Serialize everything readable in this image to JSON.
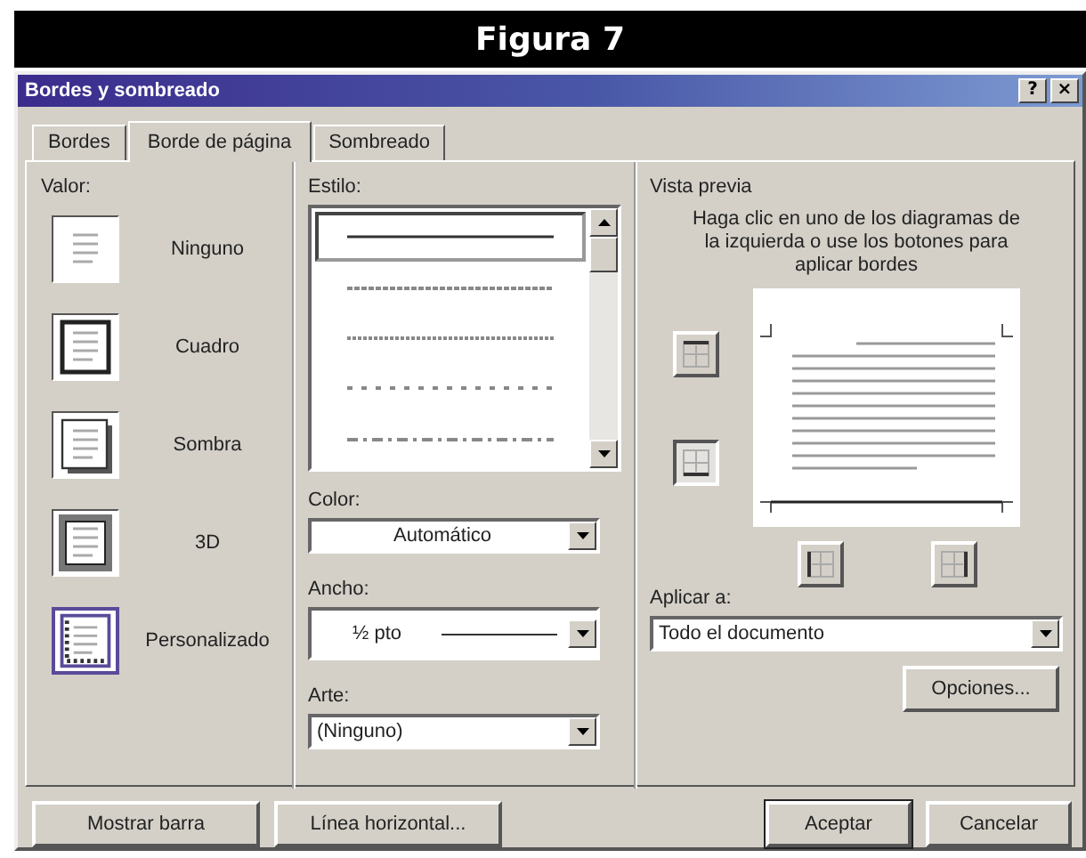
{
  "figure": {
    "caption": "Figura 7"
  },
  "window": {
    "title": "Bordes y sombreado",
    "controls": [
      {
        "label": "?"
      },
      {
        "label": "×"
      }
    ]
  },
  "tabs": [
    {
      "label": "Bordes",
      "selected": false
    },
    {
      "label": "Borde de página",
      "selected": true
    },
    {
      "label": "Sombreado",
      "selected": false
    }
  ],
  "setting": {
    "label": "Valor:",
    "options": [
      {
        "label": "Ninguno",
        "kind": "none",
        "selected": false
      },
      {
        "label": "Cuadro",
        "kind": "box",
        "selected": false
      },
      {
        "label": "Sombra",
        "kind": "shadow",
        "selected": false
      },
      {
        "label": "3D",
        "kind": "raised",
        "selected": false
      },
      {
        "label": "Personalizado",
        "kind": "custom",
        "selected": true
      }
    ]
  },
  "style": {
    "label": "Estilo:",
    "lines": [
      {
        "kind": "solid",
        "selected": true
      },
      {
        "kind": "dotted",
        "selected": false
      },
      {
        "kind": "dense-dash",
        "selected": false
      },
      {
        "kind": "dash",
        "selected": false
      },
      {
        "kind": "dash-dot",
        "selected": false
      }
    ]
  },
  "color": {
    "label": "Color:",
    "value": "Automático"
  },
  "width": {
    "label": "Ancho:",
    "value": "½ pto"
  },
  "art": {
    "label": "Arte:",
    "value": "(Ninguno)"
  },
  "preview": {
    "label": "Vista previa",
    "hint": "Haga clic en uno de los diagramas de la izquierda o use los botones para aplicar bordes",
    "edge_buttons": [
      {
        "kind": "top",
        "on": false
      },
      {
        "kind": "bottom",
        "on": true
      },
      {
        "kind": "left",
        "on": false
      },
      {
        "kind": "right",
        "on": false
      }
    ]
  },
  "apply_to": {
    "label": "Aplicar a:",
    "value": "Todo el documento"
  },
  "options_button": "Opciones...",
  "buttons": [
    {
      "label": "Mostrar barra",
      "default": false
    },
    {
      "label": "Línea horizontal...",
      "default": false
    },
    {
      "label": "Aceptar",
      "default": true
    },
    {
      "label": "Cancelar",
      "default": false
    }
  ]
}
